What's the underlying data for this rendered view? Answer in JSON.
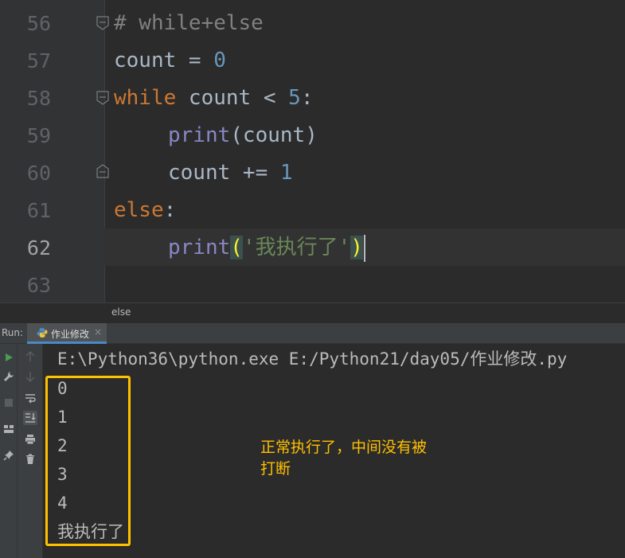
{
  "editor": {
    "lines": [
      {
        "num": "56"
      },
      {
        "num": "57"
      },
      {
        "num": "58"
      },
      {
        "num": "59"
      },
      {
        "num": "60"
      },
      {
        "num": "61"
      },
      {
        "num": "62"
      },
      {
        "num": "63"
      }
    ],
    "code": {
      "l56_comment": "# while+else",
      "l57_var": "count",
      "l57_op": " = ",
      "l57_num": "0",
      "l58_kw": "while",
      "l58_rest": " count < ",
      "l58_num": "5",
      "l58_colon": ":",
      "l59_fn": "print",
      "l59_rest": "(count)",
      "l60_var": "count",
      "l60_op": " += ",
      "l60_num": "1",
      "l61_kw": "else",
      "l61_colon": ":",
      "l62_fn": "print",
      "l62_open": "(",
      "l62_str": "'我执行了'",
      "l62_close": ")"
    }
  },
  "breadcrumb": {
    "text": "else"
  },
  "run": {
    "label": "Run:",
    "tab_title": "作业修改",
    "tab_close": "×",
    "command": "E:\\Python36\\python.exe E:/Python21/day05/作业修改.py",
    "output": [
      "0",
      "1",
      "2",
      "3",
      "4",
      "我执行了"
    ]
  },
  "annotation": {
    "line1": "正常执行了，中间没有被",
    "line2": "打断"
  },
  "colors": {
    "highlight": "#ffc000",
    "keyword": "#cc7832",
    "number": "#6897bb",
    "string": "#6a8759",
    "builtin": "#8888c6"
  },
  "icons": [
    "fold-icon",
    "python-icon",
    "run-icon",
    "wrench-icon",
    "stop-icon",
    "layout-icon",
    "pin-icon",
    "up-arrow-icon",
    "down-arrow-icon",
    "soft-wrap-icon",
    "scroll-to-end-icon",
    "print-icon",
    "trash-icon"
  ]
}
